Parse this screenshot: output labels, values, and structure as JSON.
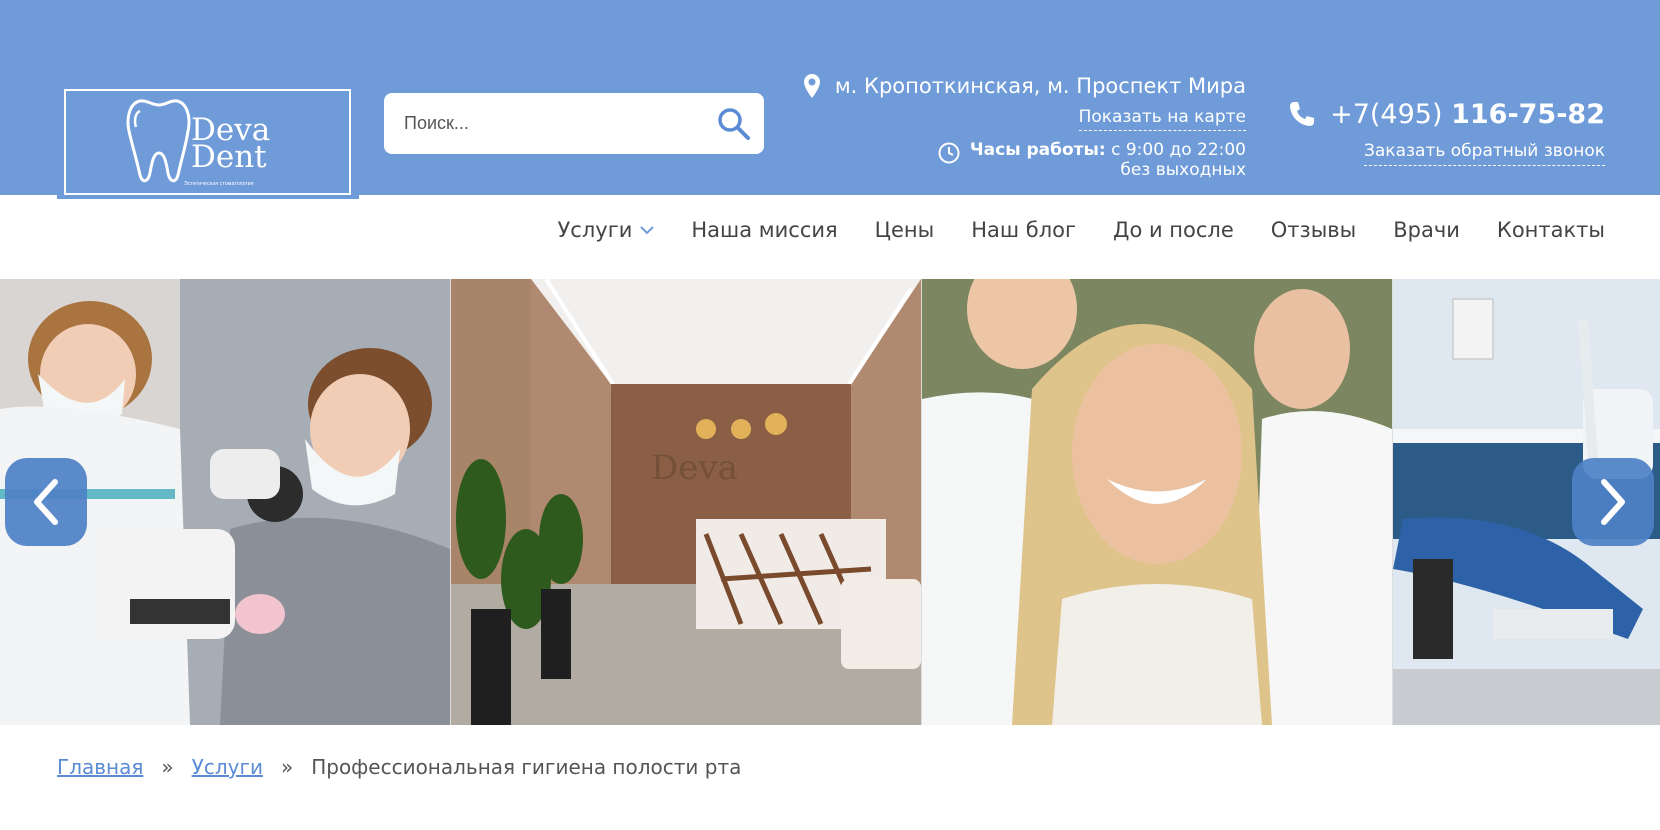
{
  "header": {
    "logo": {
      "line1": "Deva",
      "line2": "Dent",
      "tagline": "Эстетическая стоматология"
    },
    "search": {
      "placeholder": "Поиск..."
    },
    "address": {
      "metro": "м. Кропоткинская, м. Проспект Мира",
      "map_link": "Показать на карте",
      "hours_label": "Часы работы:",
      "hours_value": "с 9:00 до 22:00",
      "hours_note": "без выходных"
    },
    "contact": {
      "phone_prefix": "+7(495)",
      "phone_number": "116-75-82",
      "callback_link": "Заказать обратный звонок"
    }
  },
  "nav": {
    "items": [
      {
        "label": "Услуги",
        "has_dropdown": true
      },
      {
        "label": "Наша миссия"
      },
      {
        "label": "Цены"
      },
      {
        "label": "Наш блог"
      },
      {
        "label": "До и после"
      },
      {
        "label": "Отзывы"
      },
      {
        "label": "Врачи"
      },
      {
        "label": "Контакты"
      }
    ]
  },
  "breadcrumb": {
    "home": "Главная",
    "services": "Услуги",
    "current": "Профессиональная гигиена полости рта",
    "separator": "»"
  },
  "colors": {
    "header_bg": "#6f9bd9",
    "accent": "#5a8bd4",
    "slider_button": "#4e80c6"
  },
  "icons": {
    "search": "search-icon",
    "location": "map-pin-icon",
    "clock": "clock-icon",
    "phone": "phone-icon",
    "dropdown": "chevron-down-icon",
    "prev": "chevron-left-icon",
    "next": "chevron-right-icon"
  }
}
